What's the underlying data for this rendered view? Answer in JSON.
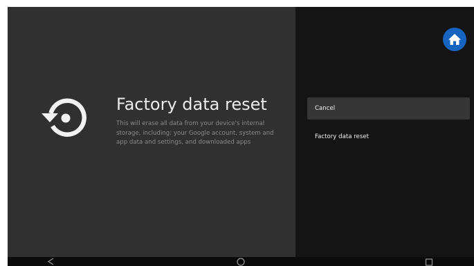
{
  "screen": {
    "title": "Factory data reset",
    "description": "This will erase all data from your device's internal storage, including: your Google account, system and app data and settings, and downloaded apps",
    "icon": "restore-icon"
  },
  "actions": {
    "items": [
      {
        "label": "Cancel",
        "selected": true
      },
      {
        "label": "Factory data reset",
        "selected": false
      }
    ]
  },
  "home_button": {
    "icon": "home-icon",
    "color": "#1565c0"
  },
  "nav_bar": {
    "buttons": [
      "back-icon",
      "home-icon",
      "recents-icon"
    ]
  }
}
